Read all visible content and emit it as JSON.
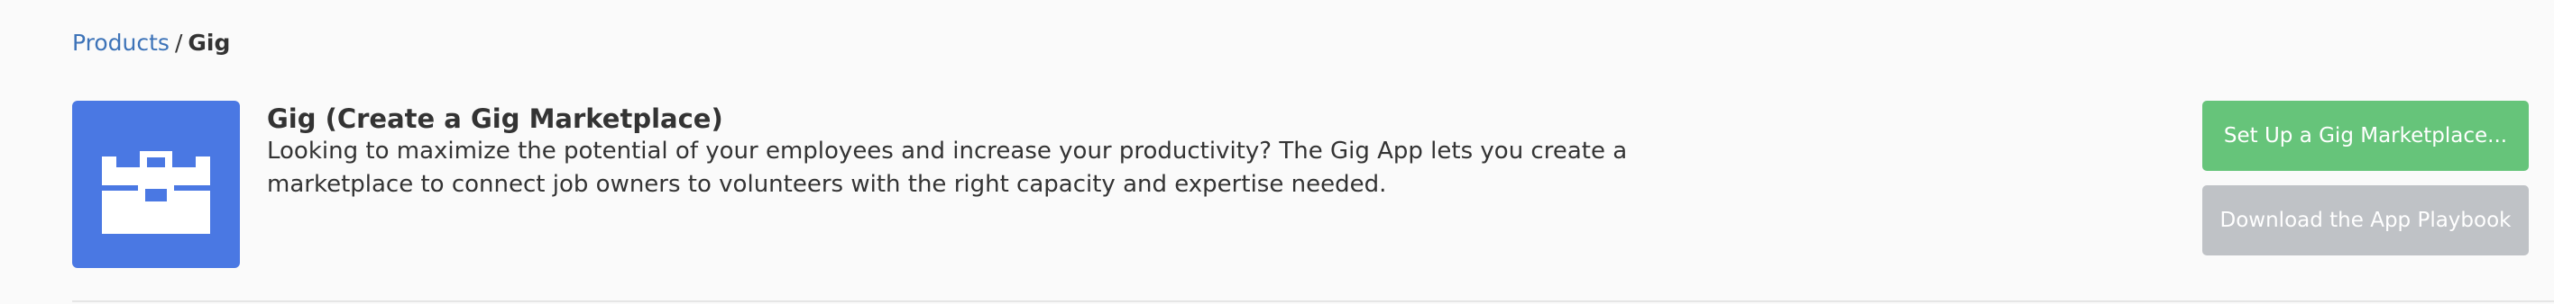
{
  "breadcrumb": {
    "parent_label": "Products",
    "separator": "/",
    "current_label": "Gig"
  },
  "app": {
    "icon": "briefcase-icon",
    "icon_background": "#4a78e3",
    "title": "Gig (Create a Gig Marketplace)",
    "description": "Looking to maximize the potential of your employees and increase your productivity? The Gig App lets you create a marketplace to connect job owners to volunteers with the right capacity and expertise needed."
  },
  "actions": {
    "setup_label": "Set Up a Gig Marketplace...",
    "setup_color": "#66c47a",
    "playbook_label": "Download the App Playbook",
    "playbook_color": "#bfc2c6"
  }
}
